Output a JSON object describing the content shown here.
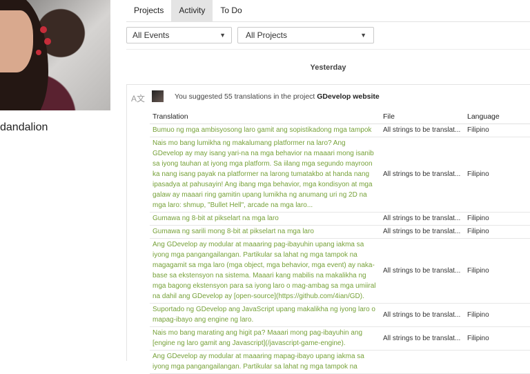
{
  "profile": {
    "name": "dandalion"
  },
  "tabs": [
    {
      "label": "Projects",
      "active": false
    },
    {
      "label": "Activity",
      "active": true
    },
    {
      "label": "To Do",
      "active": false
    }
  ],
  "filters": {
    "events": {
      "selected": "All Events"
    },
    "projects": {
      "selected": "All Projects"
    }
  },
  "day_header": "Yesterday",
  "activity": {
    "summary_prefix": "You suggested 55 translations in the project",
    "project_name": "GDevelop website",
    "columns": {
      "translation": "Translation",
      "file": "File",
      "language": "Language"
    },
    "rows": [
      {
        "translation": "Bumuo ng mga ambisyosong laro gamit ang sopistikadong mga tampok",
        "file": "All strings to be translat...",
        "language": "Filipino"
      },
      {
        "translation": "Nais mo bang lumikha ng makalumang platformer na laro? Ang GDevelop ay may isang yari-na na mga behavior na maaari mong isanib sa iyong tauhan at iyong mga platform. Sa iilang mga segundo mayroon ka nang isang payak na platformer na larong tumatakbo at handa nang ipasadya at pahusayin! Ang ibang mga behavior, mga kondisyon at mga galaw ay maaari ring gamitin upang lumikha ng anumang uri ng 2D na mga laro: shmup, \"Bullet Hell\", arcade na mga laro...",
        "file": "All strings to be translat...",
        "language": "Filipino"
      },
      {
        "translation": "Gumawa ng 8-bit at pikselart na mga laro",
        "file": "All strings to be translat...",
        "language": "Filipino"
      },
      {
        "translation": "Gumawa ng sarili mong 8-bit at pikselart na mga laro",
        "file": "All strings to be translat...",
        "language": "Filipino"
      },
      {
        "translation": "Ang GDevelop ay modular at maaaring pag-ibayuhin upang iakma sa iyong mga pangangailangan. Partikular sa lahat ng mga tampok na magagamit sa mga laro (mga object, mga behavior, mga event) ay naka-base sa ekstensyon na sistema. Maaari kang mabilis na makalikha ng mga bagong ekstensyon para sa iyong laro o mag-ambag sa mga umiiral na dahil ang GDevelop ay [open-source](https://github.com/4ian/GD).",
        "file": "All strings to be translat...",
        "language": "Filipino"
      },
      {
        "translation": "Suportado ng GDevelop ang JavaScript upang makalikha ng iyong laro o mapag-ibayo ang engine ng laro.",
        "file": "All strings to be translat...",
        "language": "Filipino"
      },
      {
        "translation": "Nais mo bang marating ang higit pa? Maaari mong pag-ibayuhin ang [engine ng laro gamit ang Javascript](/javascript-game-engine).",
        "file": "All strings to be translat...",
        "language": "Filipino"
      },
      {
        "translation": "Ang GDevelop ay modular at maaaring mapag-ibayo upang iakma sa iyong mga pangangailangan. Partikular sa lahat ng mga tampok na",
        "file": "",
        "language": ""
      }
    ]
  },
  "icons": {
    "translate": "translate-icon",
    "dropdown": "caret-down-icon"
  }
}
